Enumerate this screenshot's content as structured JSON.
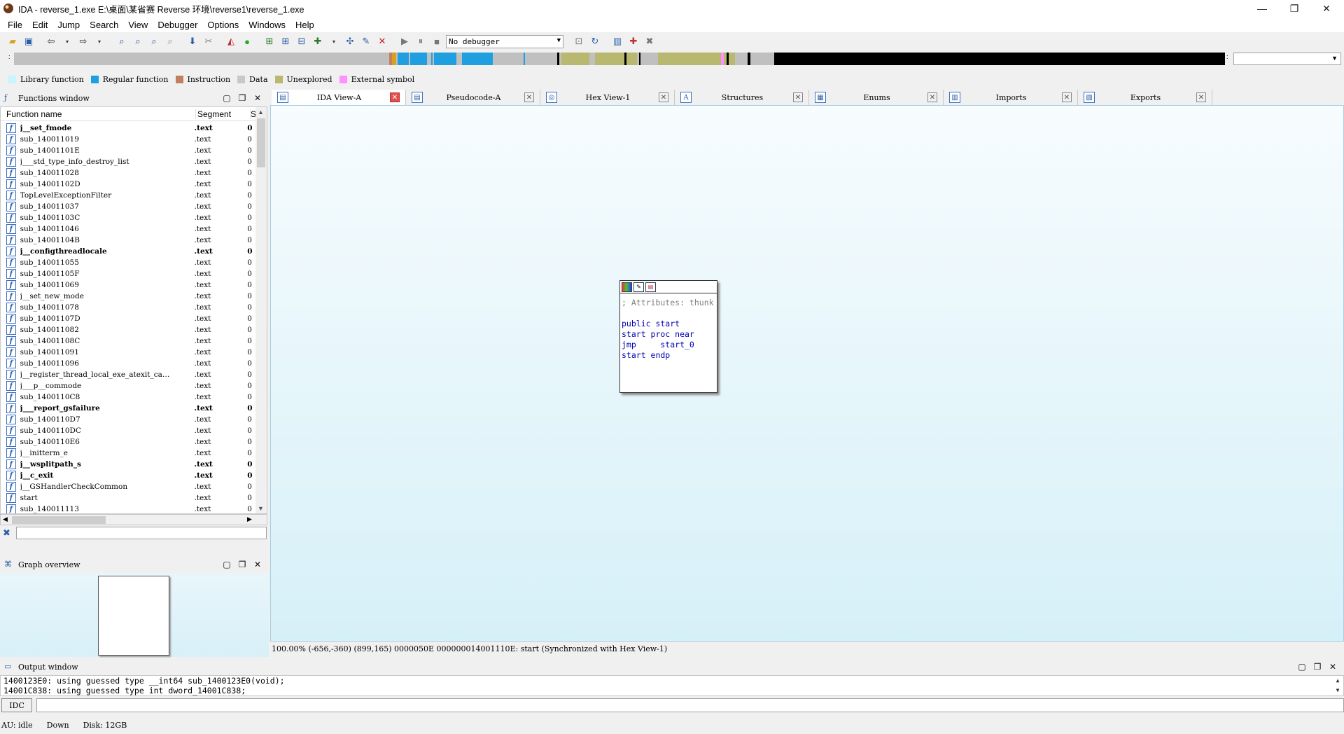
{
  "window": {
    "title": "IDA - reverse_1.exe E:\\桌面\\某省赛 Reverse 环境\\reverse1\\reverse_1.exe",
    "min": "—",
    "max": "❐",
    "close": "✕"
  },
  "menu": [
    "File",
    "Edit",
    "Jump",
    "Search",
    "View",
    "Debugger",
    "Options",
    "Windows",
    "Help"
  ],
  "toolbar": {
    "debugger_select": "No debugger"
  },
  "legend": [
    {
      "label": "Library function",
      "color": "#c6f5fb"
    },
    {
      "label": "Regular function",
      "color": "#1f9fe0"
    },
    {
      "label": "Instruction",
      "color": "#c08060"
    },
    {
      "label": "Data",
      "color": "#c8c8c8"
    },
    {
      "label": "Unexplored",
      "color": "#b8b870"
    },
    {
      "label": "External symbol",
      "color": "#ff90ff"
    }
  ],
  "functions_window": {
    "title": "Functions window",
    "columns": [
      "Function name",
      "Segment",
      "S"
    ],
    "rows": [
      {
        "name": "j__set_fmode",
        "segment": ".text",
        "start": "0",
        "bold": true
      },
      {
        "name": "sub_140011019",
        "segment": ".text",
        "start": "0",
        "bold": false
      },
      {
        "name": "sub_14001101E",
        "segment": ".text",
        "start": "0",
        "bold": false
      },
      {
        "name": "j___std_type_info_destroy_list",
        "segment": ".text",
        "start": "0",
        "bold": false
      },
      {
        "name": "sub_140011028",
        "segment": ".text",
        "start": "0",
        "bold": false
      },
      {
        "name": "sub_14001102D",
        "segment": ".text",
        "start": "0",
        "bold": false
      },
      {
        "name": "TopLevelExceptionFilter",
        "segment": ".text",
        "start": "0",
        "bold": false
      },
      {
        "name": "sub_140011037",
        "segment": ".text",
        "start": "0",
        "bold": false
      },
      {
        "name": "sub_14001103C",
        "segment": ".text",
        "start": "0",
        "bold": false
      },
      {
        "name": "sub_140011046",
        "segment": ".text",
        "start": "0",
        "bold": false
      },
      {
        "name": "sub_14001104B",
        "segment": ".text",
        "start": "0",
        "bold": false
      },
      {
        "name": "j__configthreadlocale",
        "segment": ".text",
        "start": "0",
        "bold": true
      },
      {
        "name": "sub_140011055",
        "segment": ".text",
        "start": "0",
        "bold": false
      },
      {
        "name": "sub_14001105F",
        "segment": ".text",
        "start": "0",
        "bold": false
      },
      {
        "name": "sub_140011069",
        "segment": ".text",
        "start": "0",
        "bold": false
      },
      {
        "name": "j__set_new_mode",
        "segment": ".text",
        "start": "0",
        "bold": false
      },
      {
        "name": "sub_140011078",
        "segment": ".text",
        "start": "0",
        "bold": false
      },
      {
        "name": "sub_14001107D",
        "segment": ".text",
        "start": "0",
        "bold": false
      },
      {
        "name": "sub_140011082",
        "segment": ".text",
        "start": "0",
        "bold": false
      },
      {
        "name": "sub_14001108C",
        "segment": ".text",
        "start": "0",
        "bold": false
      },
      {
        "name": "sub_140011091",
        "segment": ".text",
        "start": "0",
        "bold": false
      },
      {
        "name": "sub_140011096",
        "segment": ".text",
        "start": "0",
        "bold": false
      },
      {
        "name": "j__register_thread_local_exe_atexit_ca…",
        "segment": ".text",
        "start": "0",
        "bold": false
      },
      {
        "name": "j___p__commode",
        "segment": ".text",
        "start": "0",
        "bold": false
      },
      {
        "name": "sub_1400110C8",
        "segment": ".text",
        "start": "0",
        "bold": false
      },
      {
        "name": "j___report_gsfailure",
        "segment": ".text",
        "start": "0",
        "bold": true
      },
      {
        "name": "sub_1400110D7",
        "segment": ".text",
        "start": "0",
        "bold": false
      },
      {
        "name": "sub_1400110DC",
        "segment": ".text",
        "start": "0",
        "bold": false
      },
      {
        "name": "sub_1400110E6",
        "segment": ".text",
        "start": "0",
        "bold": false
      },
      {
        "name": "j__initterm_e",
        "segment": ".text",
        "start": "0",
        "bold": false
      },
      {
        "name": "j__wsplitpath_s",
        "segment": ".text",
        "start": "0",
        "bold": true
      },
      {
        "name": "j__c_exit",
        "segment": ".text",
        "start": "0",
        "bold": true
      },
      {
        "name": "j__GSHandlerCheckCommon",
        "segment": ".text",
        "start": "0",
        "bold": false
      },
      {
        "name": "start",
        "segment": ".text",
        "start": "0",
        "bold": false
      },
      {
        "name": "sub_140011113",
        "segment": ".text",
        "start": "0",
        "bold": false
      }
    ]
  },
  "graph_overview": {
    "title": "Graph overview"
  },
  "tabs": [
    {
      "label": "IDA View-A",
      "icon": "▤",
      "active": true
    },
    {
      "label": "Pseudocode-A",
      "icon": "▤",
      "active": false
    },
    {
      "label": "Hex View-1",
      "icon": "◎",
      "active": false
    },
    {
      "label": "Structures",
      "icon": "A",
      "active": false
    },
    {
      "label": "Enums",
      "icon": "▦",
      "active": false
    },
    {
      "label": "Imports",
      "icon": "▥",
      "active": false
    },
    {
      "label": "Exports",
      "icon": "▧",
      "active": false
    }
  ],
  "graph_node": {
    "comment": "; Attributes: thunk",
    "lines": [
      "public start",
      "start proc near",
      "jmp     start_0",
      "start endp"
    ]
  },
  "view_status": "100.00% (-656,-360) (899,165) 0000050E 000000014001110E: start (Synchronized with Hex View-1)",
  "output_window": {
    "title": "Output window",
    "lines": [
      "1400123E0: using guessed type __int64 sub_1400123E0(void);",
      "14001C838: using guessed type int dword_14001C838;"
    ]
  },
  "idc_label": "IDC",
  "statusbar": {
    "au": "AU:  idle",
    "dir": "Down",
    "disk": "Disk: 12GB"
  }
}
